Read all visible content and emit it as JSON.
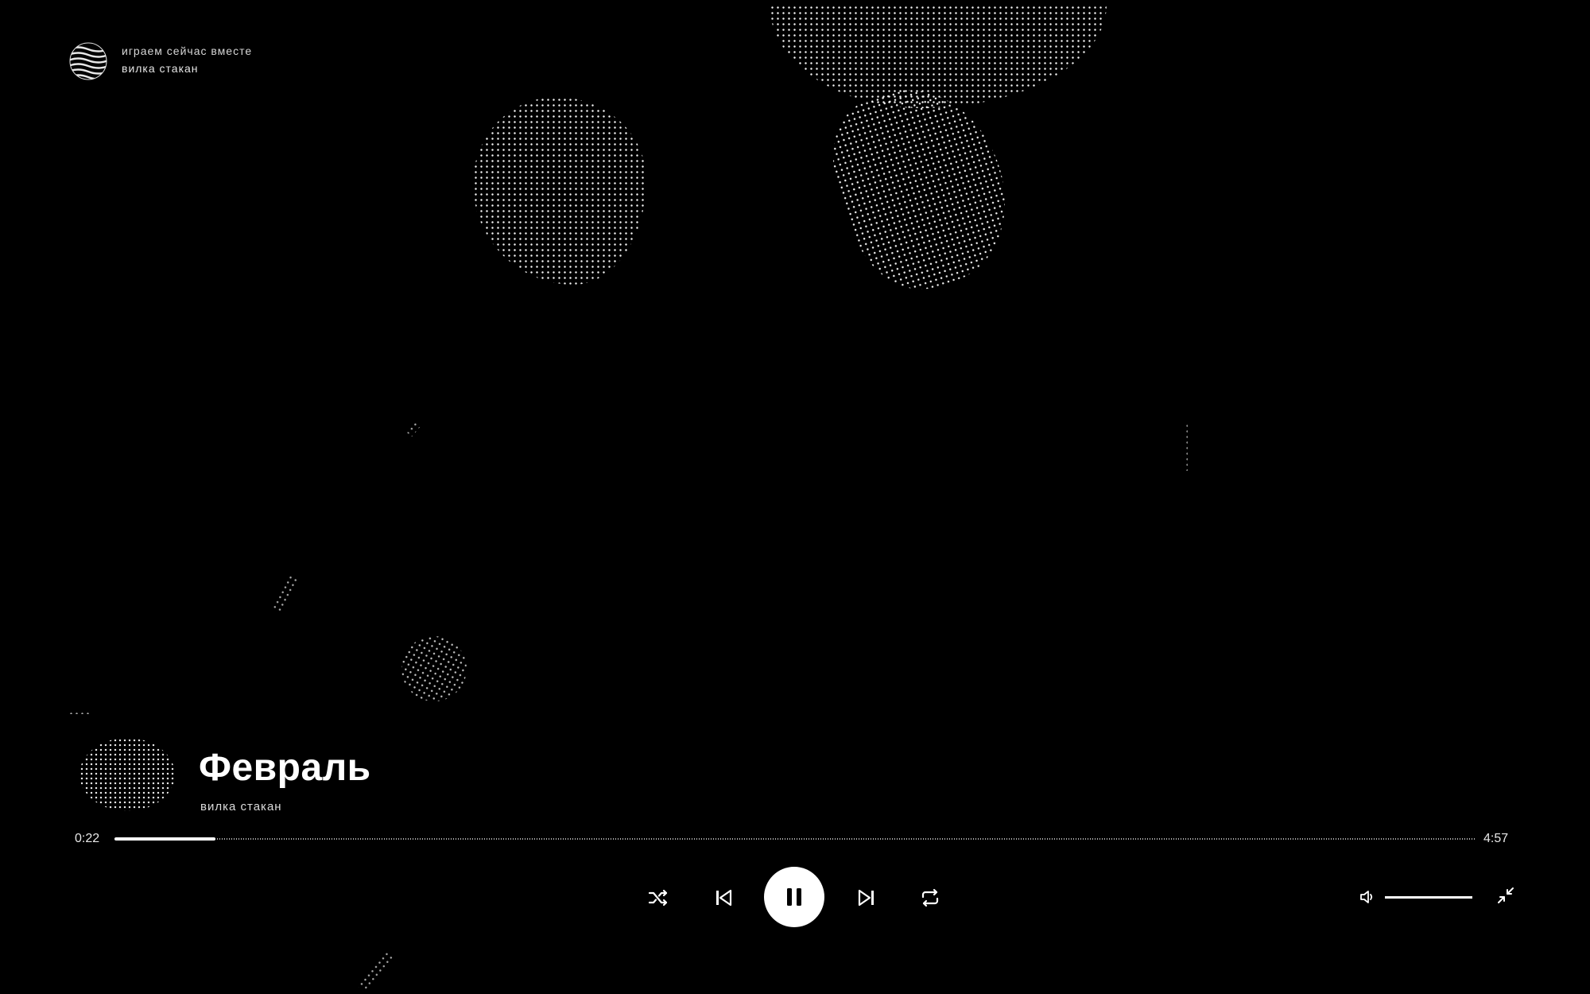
{
  "header": {
    "line1": "играем сейчас вместе",
    "line2": "вилка стакан",
    "logo_icon": "wave-globe-logo-icon"
  },
  "track": {
    "title": "Февраль",
    "artist": "вилка стакан",
    "cover_icon": "dotted-cover-icon"
  },
  "progress": {
    "current": "0:22",
    "total": "4:57",
    "fraction": 0.074
  },
  "controls": {
    "shuffle_icon": "shuffle-icon",
    "prev_icon": "skip-previous-icon",
    "pause_icon": "pause-icon",
    "next_icon": "skip-next-icon",
    "repeat_icon": "repeat-icon",
    "volume_icon": "volume-icon",
    "minimize_icon": "minimize-icon",
    "volume_level": 1.0
  },
  "colors": {
    "background": "#000000",
    "foreground": "#ffffff"
  }
}
